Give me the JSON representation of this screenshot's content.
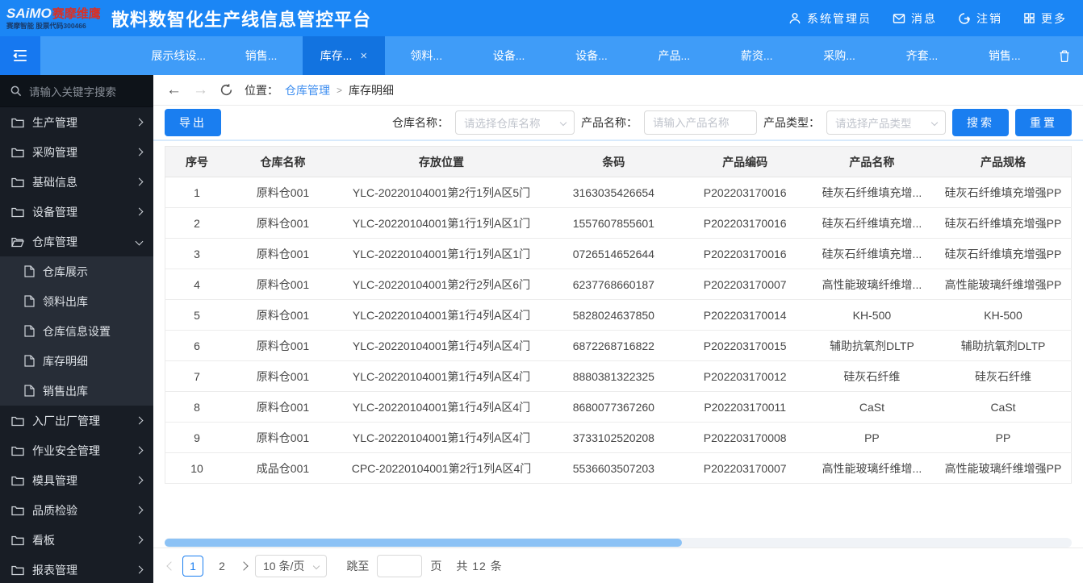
{
  "header": {
    "brand": "SAiMO",
    "brand_red": "赛摩维鹰",
    "brand_sub": "赛摩智能 股票代码300466",
    "title": "散料数智化生产线信息管控平台",
    "user_label": "系统管理员",
    "messages_label": "消息",
    "logout_label": "注销",
    "more_label": "更多"
  },
  "tabbar": {
    "tabs": [
      {
        "label": "展示线设...",
        "active": false
      },
      {
        "label": "销售...",
        "active": false
      },
      {
        "label": "库存...",
        "active": true,
        "closable": true
      },
      {
        "label": "领料...",
        "active": false
      },
      {
        "label": "设备...",
        "active": false
      },
      {
        "label": "设备...",
        "active": false
      },
      {
        "label": "产品...",
        "active": false
      },
      {
        "label": "薪资...",
        "active": false
      },
      {
        "label": "采购...",
        "active": false
      },
      {
        "label": "齐套...",
        "active": false
      },
      {
        "label": "销售...",
        "active": false
      }
    ]
  },
  "sidebar": {
    "search_placeholder": "请输入关键字搜索",
    "menu": [
      {
        "label": "生产管理",
        "expanded": false
      },
      {
        "label": "采购管理",
        "expanded": false
      },
      {
        "label": "基础信息",
        "expanded": false
      },
      {
        "label": "设备管理",
        "expanded": false
      },
      {
        "label": "仓库管理",
        "expanded": true,
        "children": [
          "仓库展示",
          "领料出库",
          "仓库信息设置",
          "库存明细",
          "销售出库"
        ]
      },
      {
        "label": "入厂出厂管理",
        "expanded": false
      },
      {
        "label": "作业安全管理",
        "expanded": false
      },
      {
        "label": "模具管理",
        "expanded": false
      },
      {
        "label": "品质检验",
        "expanded": false
      },
      {
        "label": "看板",
        "expanded": false
      },
      {
        "label": "报表管理",
        "expanded": false
      }
    ]
  },
  "breadcrumb": {
    "location_label": "位置：",
    "parent": "仓库管理",
    "separator": ">",
    "current": "库存明细"
  },
  "filters": {
    "export_label": "导出",
    "warehouse_label": "仓库名称：",
    "warehouse_placeholder": "请选择仓库名称",
    "product_name_label": "产品名称：",
    "product_name_placeholder": "请输入产品名称",
    "product_type_label": "产品类型：",
    "product_type_placeholder": "请选择产品类型",
    "search_label": "搜索",
    "reset_label": "重置"
  },
  "table": {
    "columns": [
      "序号",
      "仓库名称",
      "存放位置",
      "条码",
      "产品编码",
      "产品名称",
      "产品规格"
    ],
    "col_widths": [
      "7%",
      "12%",
      "23%",
      "15%",
      "14%",
      "14%",
      "15%"
    ],
    "rows": [
      [
        "1",
        "原料仓001",
        "YLC-20220104001第2行1列A区5门",
        "3163035426654",
        "P202203170016",
        "硅灰石纤维填充增...",
        "硅灰石纤维填充增强PP"
      ],
      [
        "2",
        "原料仓001",
        "YLC-20220104001第1行1列A区1门",
        "1557607855601",
        "P202203170016",
        "硅灰石纤维填充增...",
        "硅灰石纤维填充增强PP"
      ],
      [
        "3",
        "原料仓001",
        "YLC-20220104001第1行1列A区1门",
        "0726514652644",
        "P202203170016",
        "硅灰石纤维填充增...",
        "硅灰石纤维填充增强PP"
      ],
      [
        "4",
        "原料仓001",
        "YLC-20220104001第2行2列A区6门",
        "6237768660187",
        "P202203170007",
        "高性能玻璃纤维增...",
        "高性能玻璃纤维增强PP"
      ],
      [
        "5",
        "原料仓001",
        "YLC-20220104001第1行4列A区4门",
        "5828024637850",
        "P202203170014",
        "KH-500",
        "KH-500"
      ],
      [
        "6",
        "原料仓001",
        "YLC-20220104001第1行4列A区4门",
        "6872268716822",
        "P202203170015",
        "辅助抗氧剂DLTP",
        "辅助抗氧剂DLTP"
      ],
      [
        "7",
        "原料仓001",
        "YLC-20220104001第1行4列A区4门",
        "8880381322325",
        "P202203170012",
        "硅灰石纤维",
        "硅灰石纤维"
      ],
      [
        "8",
        "原料仓001",
        "YLC-20220104001第1行4列A区4门",
        "8680077367260",
        "P202203170011",
        "CaSt",
        "CaSt"
      ],
      [
        "9",
        "原料仓001",
        "YLC-20220104001第1行4列A区4门",
        "3733102520208",
        "P202203170008",
        "PP",
        "PP"
      ],
      [
        "10",
        "成品仓001",
        "CPC-20220104001第2行1列A区4门",
        "5536603507203",
        "P202203170007",
        "高性能玻璃纤维增...",
        "高性能玻璃纤维增强PP"
      ]
    ]
  },
  "pagination": {
    "pages": [
      "1",
      "2"
    ],
    "active_page": "1",
    "page_size": "10 条/页",
    "jump_label": "跳至",
    "page_unit": "页",
    "total": "共 12 条"
  },
  "colors": {
    "header_blue": "#1b86f5",
    "tabbar_blue": "#3f9cf8",
    "active_tab_blue": "#1273e0",
    "collapse_blue": "#1678f0",
    "primary_button": "#1a7ef0",
    "sidebar_bg": "#181d25",
    "submenu_bg": "#272d37",
    "link_blue": "#3e8ef0",
    "scroll_thumb": "#8cc2f5",
    "brand_red": "#d93025"
  }
}
